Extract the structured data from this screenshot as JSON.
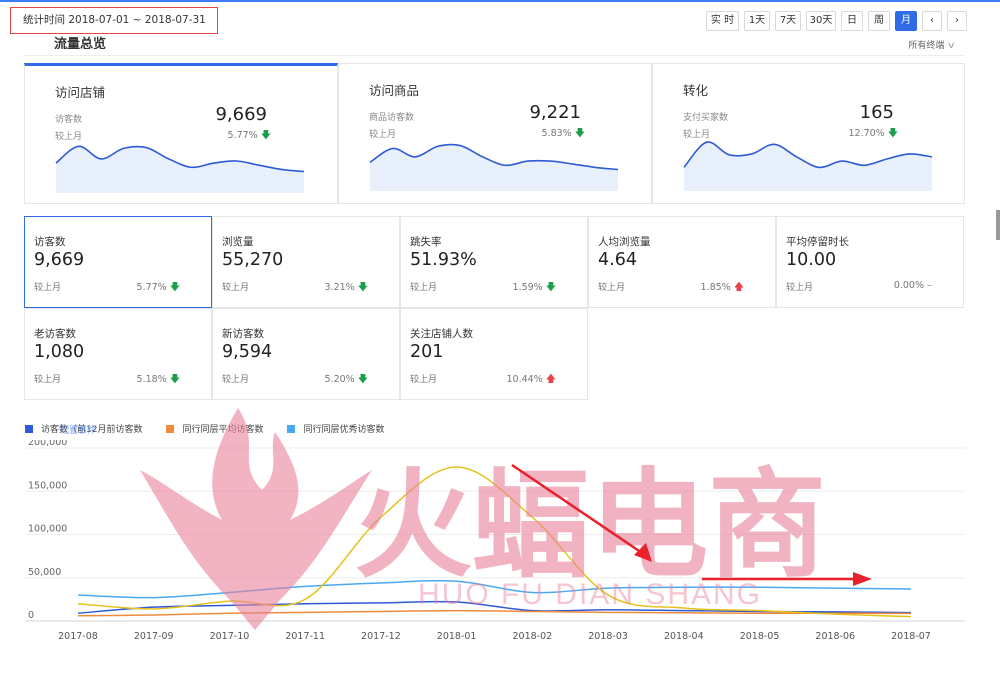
{
  "header": {
    "date_range": "统计时间 2018-07-01 ~ 2018-07-31",
    "periods": [
      {
        "label": "实 时",
        "active": false
      },
      {
        "label": "1天",
        "active": false
      },
      {
        "label": "7天",
        "active": false
      },
      {
        "label": "30天",
        "active": false
      },
      {
        "label": "日",
        "active": false
      },
      {
        "label": "周",
        "active": false
      },
      {
        "label": "月",
        "active": true
      }
    ],
    "prev": "‹",
    "next": "›",
    "section_title": "流量总览",
    "terminal": "所有终端"
  },
  "overview": [
    {
      "title": "访问店铺",
      "sublabel": "访客数",
      "compare": "较上月",
      "value": "9,669",
      "pct": "5.77%",
      "dir": "down",
      "spark": [
        0.45,
        0.85,
        0.55,
        0.8,
        0.82,
        0.55,
        0.35,
        0.45,
        0.5,
        0.4,
        0.3,
        0.25
      ],
      "active": true
    },
    {
      "title": "访问商品",
      "sublabel": "商品访客数",
      "compare": "较上月",
      "value": "9,221",
      "pct": "5.83%",
      "dir": "down",
      "spark": [
        0.42,
        0.75,
        0.55,
        0.8,
        0.82,
        0.55,
        0.35,
        0.45,
        0.45,
        0.38,
        0.3,
        0.25
      ],
      "active": false
    },
    {
      "title": "转化",
      "sublabel": "支付买家数",
      "compare": "较上月",
      "value": "165",
      "pct": "12.70%",
      "dir": "down",
      "spark": [
        0.3,
        0.9,
        0.6,
        0.62,
        0.85,
        0.55,
        0.3,
        0.45,
        0.35,
        0.5,
        0.62,
        0.55
      ],
      "active": false
    }
  ],
  "tiles": [
    {
      "label": "访客数",
      "value": "9,669",
      "compare": "较上月",
      "pct": "5.77%",
      "dir": "down",
      "active": true
    },
    {
      "label": "浏览量",
      "value": "55,270",
      "compare": "较上月",
      "pct": "3.21%",
      "dir": "down",
      "active": false
    },
    {
      "label": "跳失率",
      "value": "51.93%",
      "compare": "较上月",
      "pct": "1.59%",
      "dir": "down",
      "active": false
    },
    {
      "label": "人均浏览量",
      "value": "4.64",
      "compare": "较上月",
      "pct": "1.85%",
      "dir": "up",
      "active": false
    },
    {
      "label": "平均停留时长",
      "value": "10.00",
      "compare": "较上月",
      "pct": "0.00%",
      "dir": "flat",
      "active": false
    },
    {
      "label": "老访客数",
      "value": "1,080",
      "compare": "较上月",
      "pct": "5.18%",
      "dir": "down",
      "active": false
    },
    {
      "label": "新访客数",
      "value": "9,594",
      "compare": "较上月",
      "pct": "5.20%",
      "dir": "down",
      "active": false
    },
    {
      "label": "关注店铺人数",
      "value": "201",
      "compare": "较上月",
      "pct": "10.44%",
      "dir": "up",
      "active": false
    }
  ],
  "legend": {
    "config_link": "配置事件",
    "items": [
      {
        "name": "访客数（前12月前访客数",
        "color": "#2f5bd6"
      },
      {
        "name": "同行同层平均访客数",
        "color": "#f08a3c"
      },
      {
        "name": "同行同层优秀访客数",
        "color": "#4aa8f0"
      }
    ]
  },
  "chart_data": {
    "type": "line",
    "x": [
      "2017-08",
      "2017-09",
      "2017-10",
      "2017-11",
      "2017-12",
      "2018-01",
      "2018-02",
      "2018-03",
      "2018-04",
      "2018-05",
      "2018-06",
      "2018-07"
    ],
    "yticks": [
      "200,000",
      "150,000",
      "100,000",
      "50,000",
      "0"
    ],
    "ylim": [
      0,
      200000
    ],
    "series": [
      {
        "name": "访客数",
        "color": "#2f5bd6",
        "values": [
          9000,
          16000,
          18000,
          20000,
          21000,
          22000,
          12000,
          13000,
          12000,
          11000,
          10500,
          9669
        ]
      },
      {
        "name": "同行同层平均访客数",
        "color": "#f08a3c",
        "values": [
          6000,
          7000,
          9000,
          10000,
          11000,
          12000,
          11000,
          10000,
          9500,
          9000,
          9000,
          8800
        ]
      },
      {
        "name": "同行同层优秀访客数",
        "color": "#4aa8f0",
        "values": [
          30000,
          27000,
          33000,
          40000,
          44000,
          46000,
          33000,
          38000,
          39000,
          39000,
          38000,
          37000
        ]
      },
      {
        "name": "",
        "color": "#e6c21c",
        "values": [
          20000,
          14000,
          23000,
          25000,
          120000,
          178000,
          120000,
          30000,
          15000,
          12000,
          8000,
          5000
        ]
      }
    ]
  },
  "watermark": {
    "text_cn": "火蝠电商",
    "text_en": "HUO FU DIAN SHANG",
    "color": "#e9819b"
  }
}
